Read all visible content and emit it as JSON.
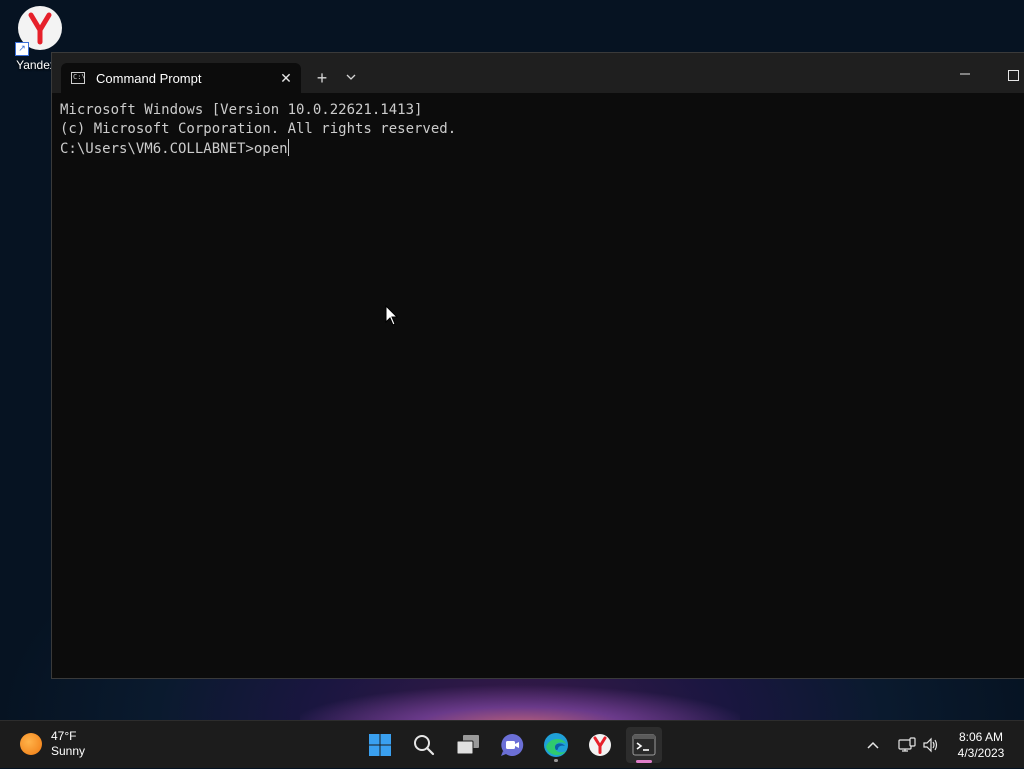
{
  "desktop": {
    "icons": [
      {
        "label": "Yandex",
        "icon": "yandex-logo-icon"
      }
    ]
  },
  "window": {
    "tab_title": "Command Prompt",
    "tab_icon": "cmd-icon",
    "buttons": {
      "new_tab": "+",
      "close_tab": "✕",
      "dropdown": "⌄",
      "minimize": "—"
    }
  },
  "console": {
    "lines": [
      "Microsoft Windows [Version 10.0.22621.1413]",
      "(c) Microsoft Corporation. All rights reserved.",
      "",
      "C:\\Users\\VM6.COLLABNET>open"
    ]
  },
  "taskbar": {
    "weather": {
      "temperature": "47°F",
      "condition": "Sunny",
      "icon": "sun-icon"
    },
    "apps": [
      {
        "name": "start-button",
        "icon": "windows-logo-icon"
      },
      {
        "name": "search-button",
        "icon": "search-icon"
      },
      {
        "name": "task-view-button",
        "icon": "task-view-icon"
      },
      {
        "name": "teams-chat-button",
        "icon": "camera-chat-icon"
      },
      {
        "name": "edge-button",
        "icon": "edge-icon"
      },
      {
        "name": "yandex-button",
        "icon": "yandex-icon"
      },
      {
        "name": "terminal-button",
        "icon": "terminal-icon",
        "active": true
      }
    ],
    "tray": {
      "overflow_icon": "chevron-up-icon",
      "network_icon": "network-icon",
      "volume_icon": "volume-icon"
    },
    "clock": {
      "time": "8:06 AM",
      "date": "4/3/2023"
    }
  },
  "colors": {
    "console_bg": "#0c0c0c",
    "console_text": "#cccccc",
    "titlebar_bg": "#1f1f1f",
    "taskbar_bg": "#1c1c1c",
    "accent_indicator": "#e07ec9"
  }
}
